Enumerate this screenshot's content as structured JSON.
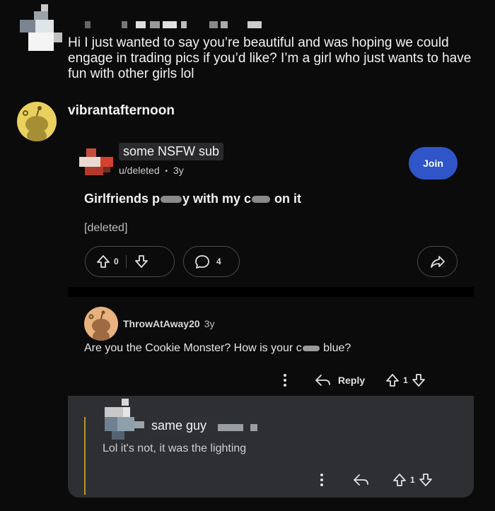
{
  "message": {
    "text": "Hi I just wanted to say you’re beautiful and was hoping we could engage in trading pics if you’d like? I’m a girl who just wants to have fun with other girls lol"
  },
  "recipient": {
    "username": "vibrantafternoon"
  },
  "post": {
    "subreddit_label": "some NSFW sub",
    "author": "u/deleted",
    "separator": "•",
    "age": "3y",
    "join_label": "Join",
    "title_part1": "Girlfriends p",
    "title_part2": "y with my c",
    "title_part3": " on it",
    "body": "[deleted]",
    "vote_count": "0",
    "comment_count": "4"
  },
  "comment": {
    "author": "ThrowAtAway20",
    "age": "3y",
    "text_part1": "Are you the Cookie Monster? How is your c",
    "text_part2": " blue?",
    "reply_label": "Reply",
    "vote_count": "1",
    "more_icon": "more-vertical-icon"
  },
  "reply": {
    "author_label": "same guy",
    "text": "Lol it's not, it was the lighting",
    "vote_count": "1"
  },
  "colors": {
    "background": "#0b0b0c",
    "join_button": "#2f55c9",
    "reply_card": "#2d2f33",
    "thread_line": "#b8962c"
  }
}
